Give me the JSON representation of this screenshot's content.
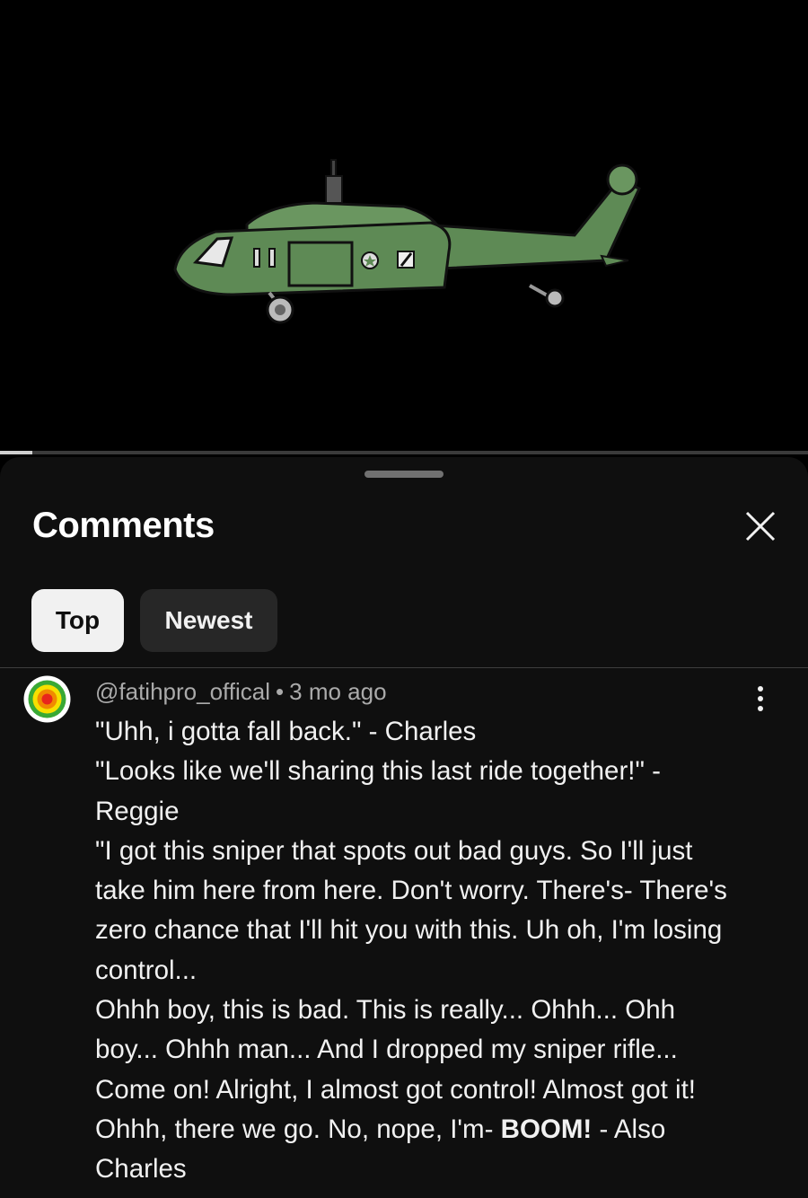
{
  "video": {
    "progress_fraction": 0.04
  },
  "sheet": {
    "title": "Comments",
    "tabs": [
      {
        "label": "Top",
        "selected": true
      },
      {
        "label": "Newest",
        "selected": false
      }
    ]
  },
  "comment": {
    "author": "@fatihpro_offical",
    "separator": "•",
    "time": "3 mo ago",
    "lines": [
      "\"Uhh, i gotta fall back.\" - Charles",
      "\"Looks like we'll sharing this last ride together!\" -",
      "Reggie",
      "\"I got this sniper that spots out bad guys. So I'll just",
      "take him here from here. Don't worry. There's- There's",
      "zero chance that I'll hit you with this. Uh oh, I'm losing",
      "control...",
      "Ohhh boy, this is bad. This is really... Ohhh... Ohh",
      "boy... Ohhh man... And I dropped my sniper rifle...",
      "Come on! Alright, I almost got control! Almost got it!"
    ],
    "line_boom_before": "Ohhh, there we go. No, nope, I'm- ",
    "line_boom_bold": "BOOM!",
    "line_boom_after": " - Also",
    "last_line": "Charles"
  },
  "colors": {
    "background": "#0f0f0f",
    "chip_selected": "#f1f1f1",
    "chip_unselected": "#272727",
    "helicopter_body": "#5e8a55"
  },
  "icons": {
    "close": "close-icon",
    "more": "more-vert-icon",
    "avatar": "avatar"
  }
}
